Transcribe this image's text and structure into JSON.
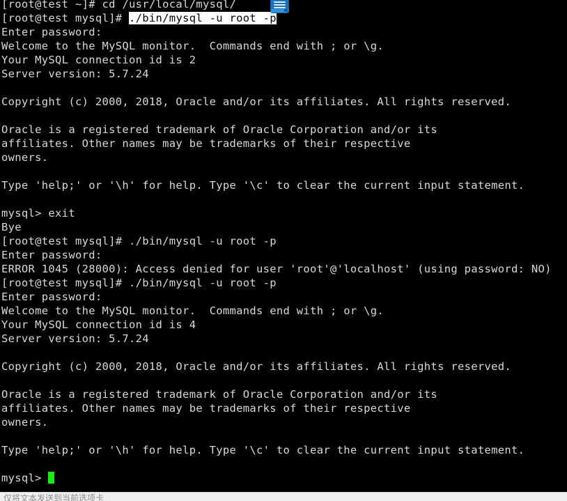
{
  "window": {
    "kind": "terminal-emulator",
    "background_color": "#000000",
    "foreground_color": "#d8d8d8",
    "selection_background": "#ffffff",
    "selection_foreground": "#000000",
    "cursor_color": "#14f014"
  },
  "overlay_icon": {
    "name": "notes-document-icon",
    "color": "#1b72b8",
    "accent_color": "#2f94d8"
  },
  "terminal": {
    "prompt_host": "[root@test ~]#",
    "prompt_dir": "[root@test mysql]#",
    "cursor": "█",
    "lines": [
      {
        "id": "l01",
        "text": "[root@test ~]# cd /usr/local/mysql/",
        "clipped_top": true
      },
      {
        "id": "l02",
        "prefix": "[root@test mysql]# ",
        "selected": "./bin/mysql -u root -p"
      },
      {
        "id": "l03",
        "text": "Enter password:"
      },
      {
        "id": "l04",
        "text": "Welcome to the MySQL monitor.  Commands end with ; or \\g."
      },
      {
        "id": "l05",
        "text": "Your MySQL connection id is 2"
      },
      {
        "id": "l06",
        "text": "Server version: 5.7.24"
      },
      {
        "id": "l07",
        "text": ""
      },
      {
        "id": "l08",
        "text": "Copyright (c) 2000, 2018, Oracle and/or its affiliates. All rights reserved."
      },
      {
        "id": "l09",
        "text": ""
      },
      {
        "id": "l10",
        "text": "Oracle is a registered trademark of Oracle Corporation and/or its"
      },
      {
        "id": "l11",
        "text": "affiliates. Other names may be trademarks of their respective"
      },
      {
        "id": "l12",
        "text": "owners."
      },
      {
        "id": "l13",
        "text": ""
      },
      {
        "id": "l14",
        "text": "Type 'help;' or '\\h' for help. Type '\\c' to clear the current input statement."
      },
      {
        "id": "l15",
        "text": ""
      },
      {
        "id": "l16",
        "text": "mysql> exit"
      },
      {
        "id": "l17",
        "text": "Bye"
      },
      {
        "id": "l18",
        "text": "[root@test mysql]# ./bin/mysql -u root -p"
      },
      {
        "id": "l19",
        "text": "Enter password:"
      },
      {
        "id": "l20",
        "text": "ERROR 1045 (28000): Access denied for user 'root'@'localhost' (using password: NO)"
      },
      {
        "id": "l21",
        "text": "[root@test mysql]# ./bin/mysql -u root -p"
      },
      {
        "id": "l22",
        "text": "Enter password:"
      },
      {
        "id": "l23",
        "text": "Welcome to the MySQL monitor.  Commands end with ; or \\g."
      },
      {
        "id": "l24",
        "text": "Your MySQL connection id is 4"
      },
      {
        "id": "l25",
        "text": "Server version: 5.7.24"
      },
      {
        "id": "l26",
        "text": ""
      },
      {
        "id": "l27",
        "text": "Copyright (c) 2000, 2018, Oracle and/or its affiliates. All rights reserved."
      },
      {
        "id": "l28",
        "text": ""
      },
      {
        "id": "l29",
        "text": "Oracle is a registered trademark of Oracle Corporation and/or its"
      },
      {
        "id": "l30",
        "text": "affiliates. Other names may be trademarks of their respective"
      },
      {
        "id": "l31",
        "text": "owners."
      },
      {
        "id": "l32",
        "text": ""
      },
      {
        "id": "l33",
        "text": "Type 'help;' or '\\h' for help. Type '\\c' to clear the current input statement."
      },
      {
        "id": "l34",
        "text": ""
      },
      {
        "id": "l35",
        "text": "mysql> ",
        "has_cursor": true
      }
    ]
  },
  "status_bar": {
    "text": "仅将文本发送到当前选项卡"
  }
}
